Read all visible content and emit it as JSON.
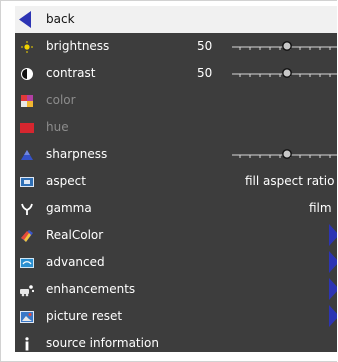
{
  "menu": {
    "items": [
      {
        "label": "back",
        "icon": "back-arrow-icon",
        "selected": true
      },
      {
        "label": "brightness",
        "value": "50",
        "icon": "sun-icon"
      },
      {
        "label": "contrast",
        "value": "50",
        "icon": "contrast-icon"
      },
      {
        "label": "color",
        "icon": "color-icon",
        "disabled": true
      },
      {
        "label": "hue",
        "icon": "hue-icon",
        "disabled": true
      },
      {
        "label": "sharpness",
        "icon": "sharpness-icon"
      },
      {
        "label": "aspect",
        "value": "fill aspect ratio",
        "icon": "aspect-icon"
      },
      {
        "label": "gamma",
        "value": "film",
        "icon": "gamma-icon"
      },
      {
        "label": "RealColor",
        "icon": "realcolor-icon"
      },
      {
        "label": "advanced",
        "icon": "advanced-icon"
      },
      {
        "label": "enhancements",
        "icon": "enhancements-icon"
      },
      {
        "label": "picture reset",
        "icon": "picture-reset-icon"
      },
      {
        "label": "source information",
        "icon": "info-icon"
      }
    ]
  },
  "sliders": {
    "brightness": 0.5,
    "contrast": 0.5,
    "sharpness": 0.5
  },
  "colors": {
    "background": "#3d3d3d",
    "selection": "#f1f1f1",
    "accent_blue": "#2d34b4",
    "disabled_text": "#8c8c8c"
  }
}
